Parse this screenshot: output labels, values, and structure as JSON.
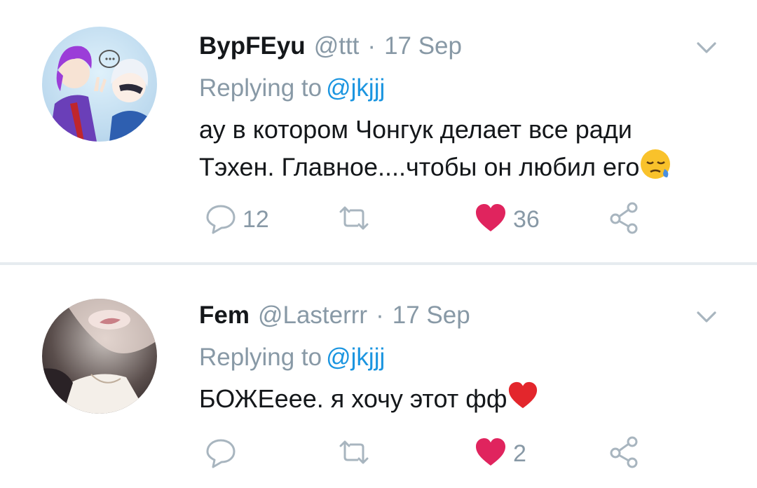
{
  "tweets": [
    {
      "name": "BypFEyu",
      "handle": "@ttt",
      "dot": "·",
      "date": "17 Sep",
      "replying_prefix": "Replying to",
      "replying_mention": "@jkjjj",
      "text_line1": "ау в котором Чонгук делает все ради",
      "text_line2": "Тэхен. Главное....чтобы он любил его",
      "emoji": "sleepy-face-icon",
      "replies": "12",
      "retweets": "",
      "likes": "36",
      "liked": true
    },
    {
      "name": "Fem",
      "handle": "@Lasterrr",
      "dot": "·",
      "date": "17 Sep",
      "replying_prefix": "Replying to",
      "replying_mention": "@jkjjj",
      "text_line1": "БОЖЕеее. я хочу этот фф",
      "emoji": "red-heart-icon",
      "replies": "",
      "retweets": "",
      "likes": "2",
      "liked": true
    }
  ],
  "colors": {
    "text": "#14171a",
    "muted": "#8899a6",
    "link": "#1b95e0",
    "like": "#e0245e",
    "divider": "#e6ecf0"
  }
}
